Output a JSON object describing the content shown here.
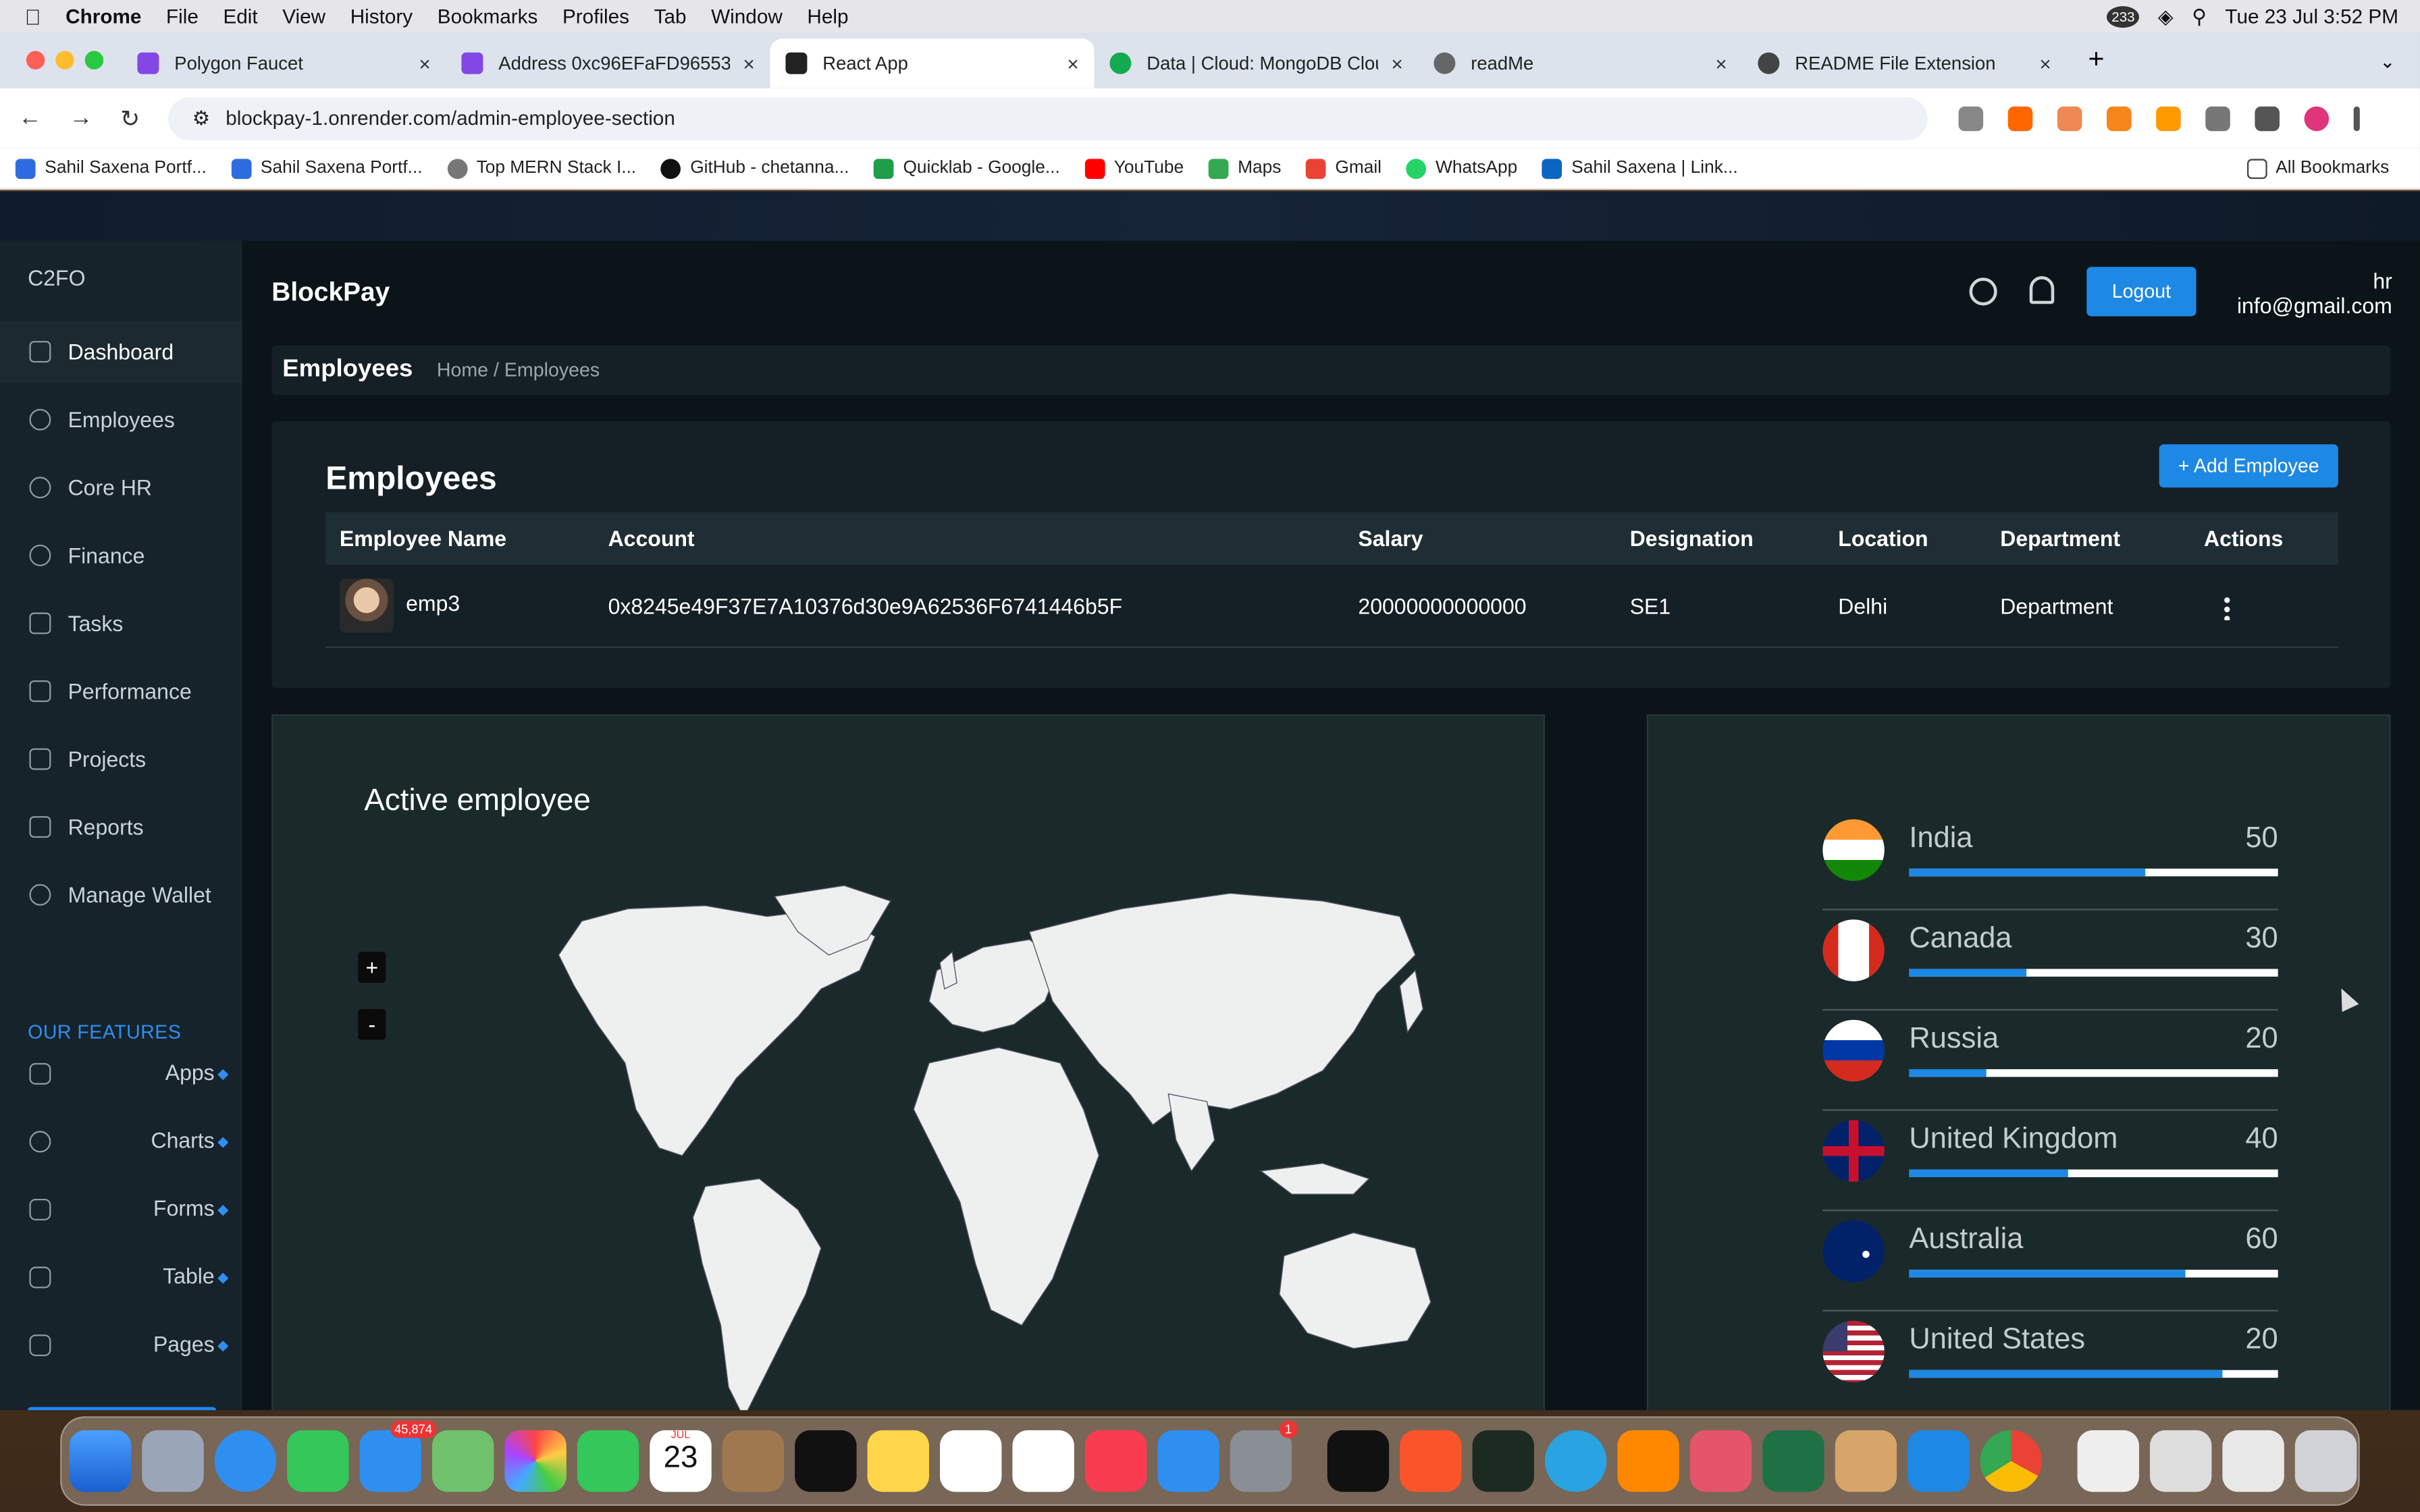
{
  "menubar": {
    "app": "Chrome",
    "items": [
      "File",
      "Edit",
      "View",
      "History",
      "Bookmarks",
      "Profiles",
      "Tab",
      "Window",
      "Help"
    ],
    "badge": "233",
    "datetime": "Tue 23 Jul  3:52 PM"
  },
  "tabs": [
    {
      "title": "Polygon Faucet",
      "color": "#8247e5"
    },
    {
      "title": "Address 0xc96EFaFD96553",
      "color": "#8247e5"
    },
    {
      "title": "React App",
      "color": "#222"
    },
    {
      "title": "Data | Cloud: MongoDB Cloud",
      "color": "#13aa52"
    },
    {
      "title": "readMe",
      "color": "#666"
    },
    {
      "title": "README File Extension",
      "color": "#444"
    }
  ],
  "url": "blockpay-1.onrender.com/admin-employee-section",
  "bookmarks": [
    {
      "label": "Sahil Saxena Portf...",
      "color": "#2d6cdf"
    },
    {
      "label": "Sahil Saxena Portf...",
      "color": "#2d6cdf"
    },
    {
      "label": "Top MERN Stack I...",
      "color": "#777"
    },
    {
      "label": "GitHub - chetanna...",
      "color": "#111"
    },
    {
      "label": "Quicklab - Google...",
      "color": "#1e9e4a"
    },
    {
      "label": "YouTube",
      "color": "#f00"
    },
    {
      "label": "Maps",
      "color": "#34a853"
    },
    {
      "label": "Gmail",
      "color": "#ea4335"
    },
    {
      "label": "WhatsApp",
      "color": "#25d366"
    },
    {
      "label": "Sahil Saxena | Link...",
      "color": "#0a66c2"
    }
  ],
  "all_bookmarks": "All Bookmarks",
  "sidebar": {
    "brand": "C2FO",
    "items": [
      "Dashboard",
      "Employees",
      "Core HR",
      "Finance",
      "Tasks",
      "Performance",
      "Projects",
      "Reports",
      "Manage Wallet"
    ],
    "features_title": "OUR FEATURES",
    "features": [
      "Apps",
      "Charts",
      "Forms",
      "Table",
      "Pages"
    ]
  },
  "header": {
    "logo": "BlockPay",
    "logout": "Logout",
    "user_role": "hr",
    "user_email": "info@gmail.com"
  },
  "crumb": {
    "title": "Employees",
    "path": "Home / Employees"
  },
  "employees": {
    "title": "Employees",
    "add_button": "+ Add Employee",
    "columns": [
      "Employee Name",
      "Account",
      "Salary",
      "Designation",
      "Location",
      "Department",
      "Actions"
    ],
    "rows": [
      {
        "name": "emp3",
        "account": "0x8245e49F37E7A10376d30e9A62536F6741446b5F",
        "salary": "20000000000000",
        "designation": "SE1",
        "location": "Delhi",
        "department": "Department"
      }
    ]
  },
  "map": {
    "title": "Active employee",
    "zoom_in": "+",
    "zoom_out": "-"
  },
  "countries": [
    {
      "name": "India",
      "value": "50",
      "fill": 0.64
    },
    {
      "name": "Canada",
      "value": "30",
      "fill": 0.32
    },
    {
      "name": "Russia",
      "value": "20",
      "fill": 0.21
    },
    {
      "name": "United Kingdom",
      "value": "40",
      "fill": 0.43
    },
    {
      "name": "Australia",
      "value": "60",
      "fill": 0.75
    },
    {
      "name": "United States",
      "value": "20",
      "fill": 0.85
    }
  ],
  "dock": {
    "mail_badge": "45,874",
    "cal_month": "JUL",
    "cal_day": "23",
    "settings_badge": "1"
  }
}
